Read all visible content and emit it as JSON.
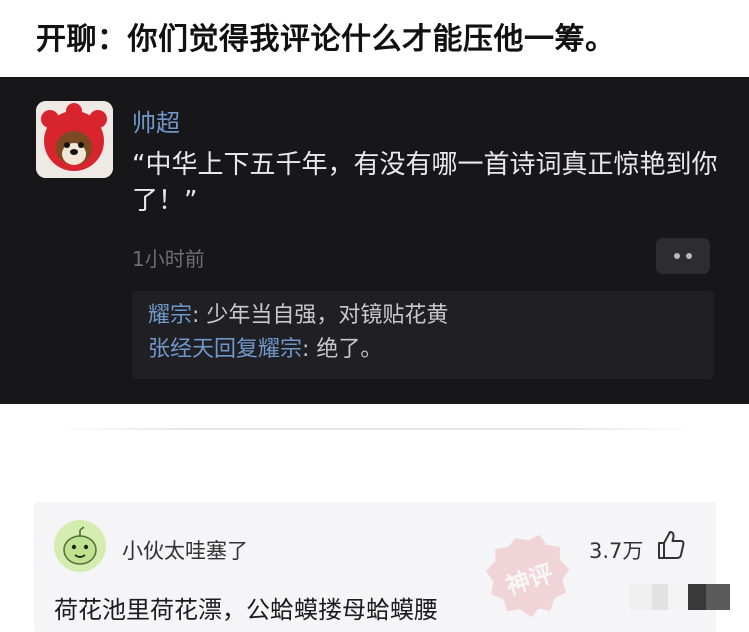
{
  "headline": "开聊：你们觉得我评论什么才能压他一筹。",
  "top_comment": {
    "author": "帅超",
    "text": "“中华上下五千年，有没有哪一首诗词真正惊艳到你了！”",
    "time": "1小时前",
    "replies": [
      {
        "name": "耀宗",
        "sep": ": ",
        "text": "少年当自强，对镜贴花黄"
      },
      {
        "name": "张经天回复耀宗",
        "sep": ": ",
        "text": "绝了。"
      }
    ]
  },
  "second_comment": {
    "author": "小伙太哇塞了",
    "likes": "3.7万",
    "text": "荷花池里荷花漂，公蛤蟆搂母蛤蟆腰"
  },
  "icons": {
    "more": "more-dots-icon",
    "like": "thumbs-up-icon",
    "avatar1": "dog-avatar",
    "avatar2": "green-cartoon-avatar"
  },
  "colors": {
    "dark_bg": "#17171a",
    "username_blue": "#6f97c9",
    "card_bg": "#f5f5f7"
  }
}
